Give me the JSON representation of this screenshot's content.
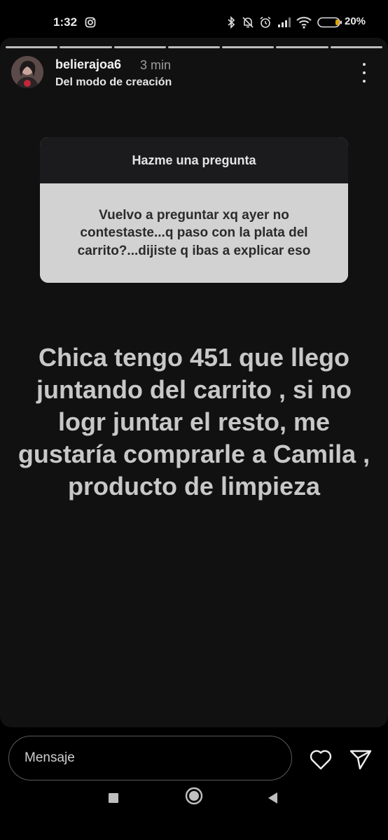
{
  "status_bar": {
    "time": "1:32",
    "battery_percent": "20%",
    "icons": [
      "instagram-icon",
      "bluetooth-icon",
      "bell-off-icon",
      "alarm-icon",
      "signal-icon",
      "wifi-icon",
      "battery-icon"
    ]
  },
  "story": {
    "progress_segments": 7,
    "username": "belierajoa6",
    "time_ago": "3 min",
    "subtitle": "Del modo de creación",
    "question_card": {
      "header": "Hazme una pregunta",
      "question": "Vuelvo a preguntar xq ayer no contestaste...q paso con la plata del carrito?...dijiste q ibas a explicar eso"
    },
    "answer_text": "Chica tengo 451 que llego juntando del carrito , si no logr juntar el resto, me gustaría comprarle a Camila , producto de limpieza"
  },
  "reply_bar": {
    "placeholder": "Mensaje"
  },
  "colors": {
    "background": "#000000",
    "story_bg": "#111111",
    "card_header": "#1b1b1e",
    "card_body": "#d2d2d2",
    "answer_text": "#c8c8c8"
  }
}
